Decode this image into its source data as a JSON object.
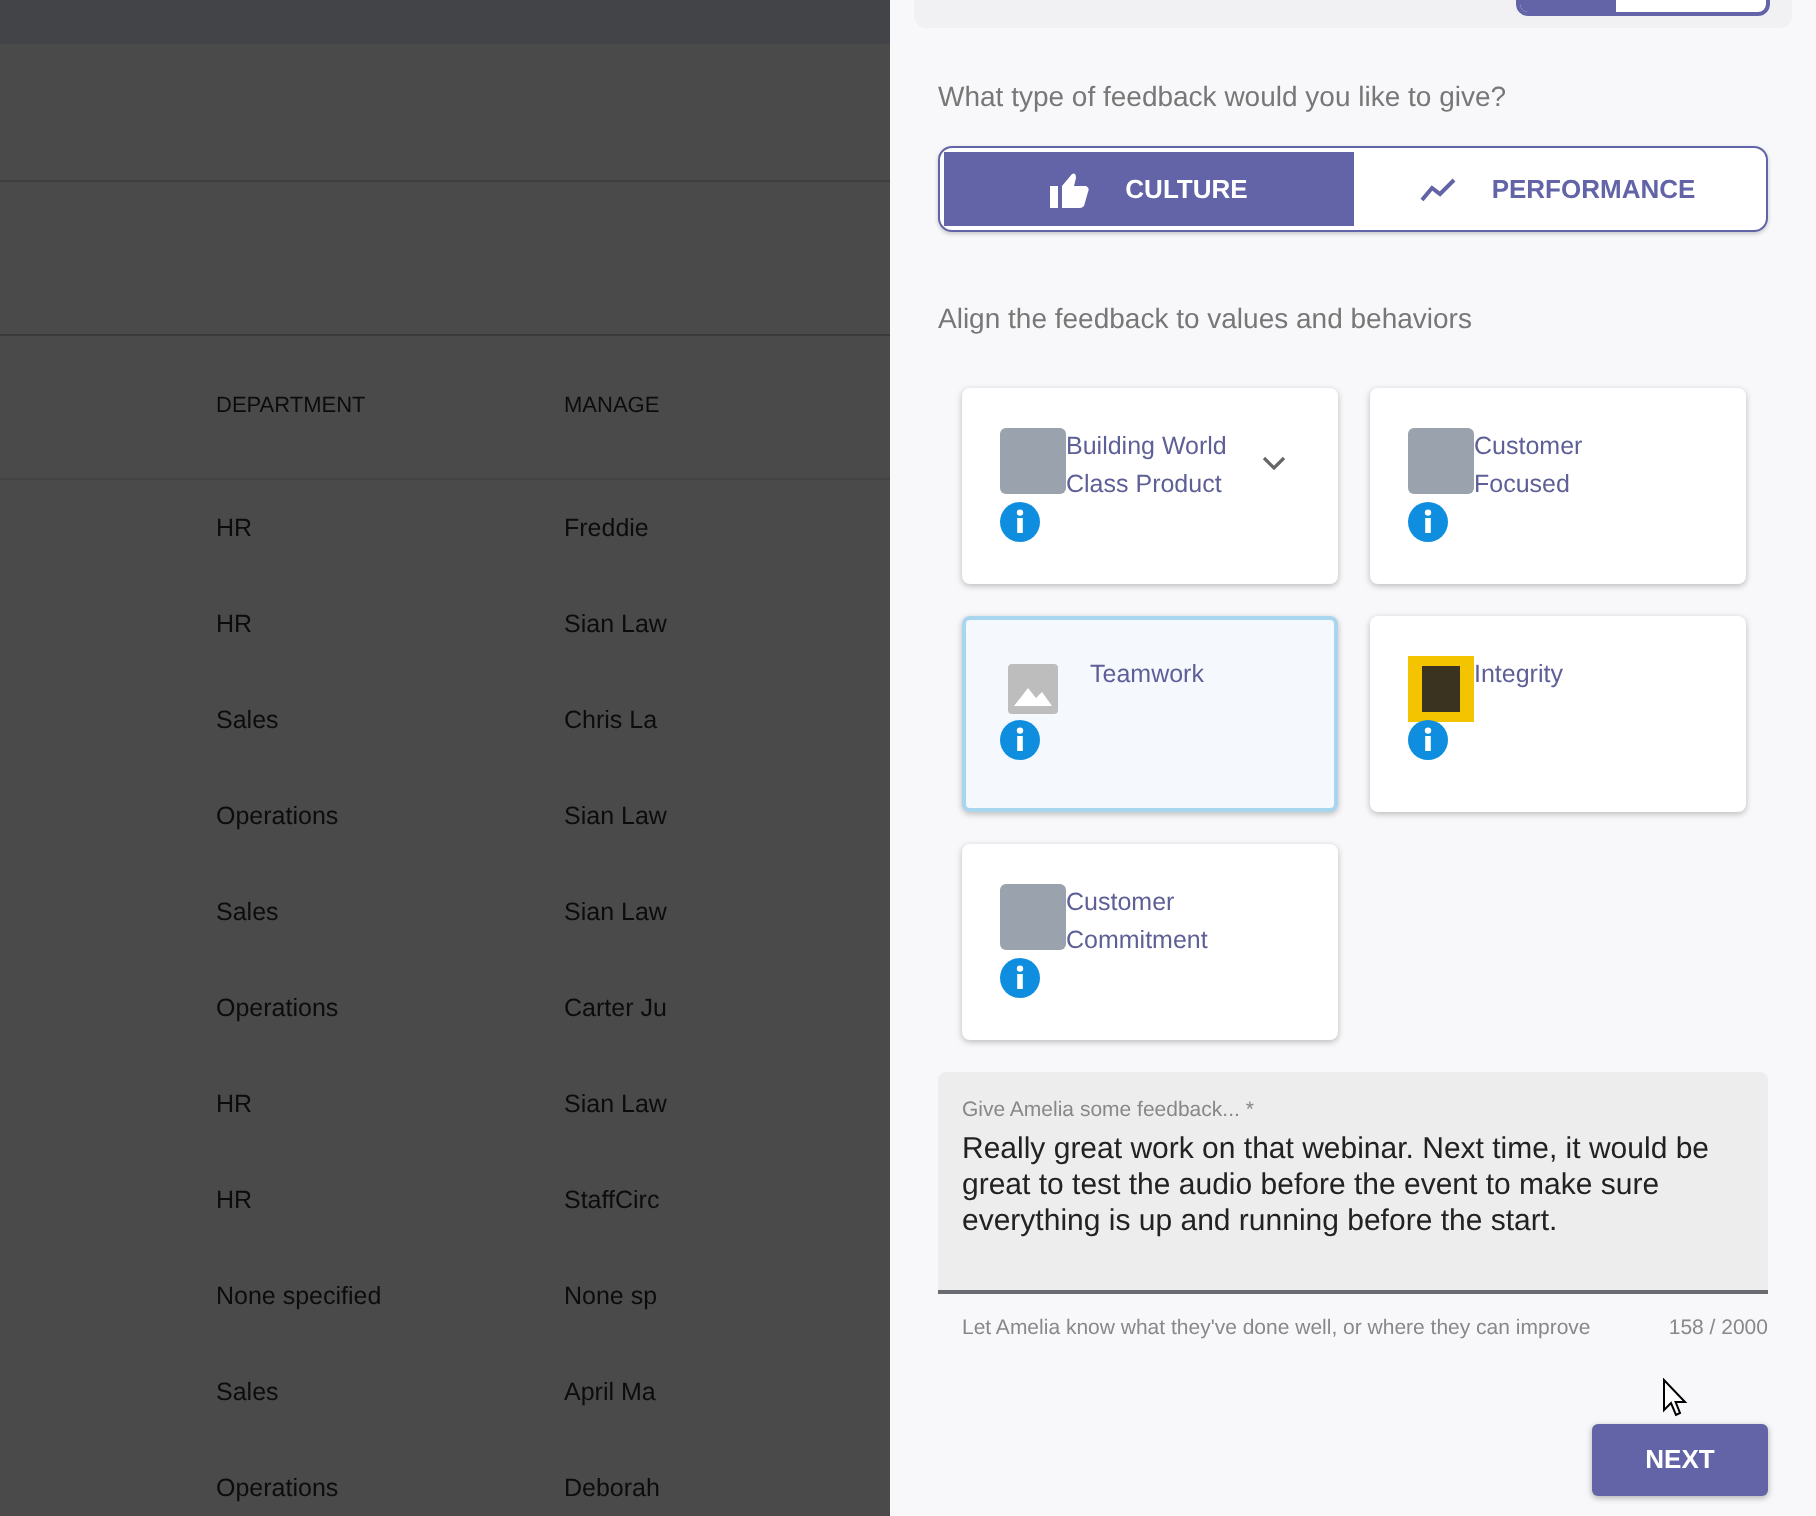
{
  "background_table": {
    "columns": [
      "DEPARTMENT",
      "MANAGE"
    ],
    "rows": [
      [
        "HR",
        "Freddie"
      ],
      [
        "HR",
        "Sian Law"
      ],
      [
        "Sales",
        "Chris La"
      ],
      [
        "Operations",
        "Sian Law"
      ],
      [
        "Sales",
        "Sian Law"
      ],
      [
        "Operations",
        "Carter Ju"
      ],
      [
        "HR",
        "Sian Law"
      ],
      [
        "HR",
        "StaffCirc"
      ],
      [
        "None specified",
        "None sp"
      ],
      [
        "Sales",
        "April Ma"
      ],
      [
        "Operations",
        "Deborah"
      ]
    ]
  },
  "panel": {
    "question": "What type of feedback would you like to give?",
    "feedback_types": [
      {
        "label": "CULTURE",
        "kind": "thumb",
        "selected": true
      },
      {
        "label": "PERFORMANCE",
        "kind": "trend",
        "selected": false
      }
    ],
    "values_label": "Align the feedback to values and behaviors",
    "values": [
      {
        "name": "Building World Class Product",
        "kind": "photo",
        "expandable": true,
        "selected": false
      },
      {
        "name": "Customer Focused",
        "kind": "photo",
        "expandable": false,
        "selected": false
      },
      {
        "name": "Teamwork",
        "kind": "placeholder",
        "expandable": false,
        "selected": true
      },
      {
        "name": "Integrity",
        "kind": "poster",
        "expandable": false,
        "selected": false
      },
      {
        "name": "Customer Commitment",
        "kind": "photo",
        "expandable": false,
        "selected": false
      }
    ],
    "feedback_field": {
      "label": "Give Amelia some feedback... *",
      "value": "Really great work on that webinar. Next time, it would be great to test the audio before the event to make sure everything is up and running before the start.",
      "hint": "Let Amelia know what they've done well, or where they can improve",
      "counter": "158 / 2000"
    },
    "next_button": "NEXT"
  }
}
